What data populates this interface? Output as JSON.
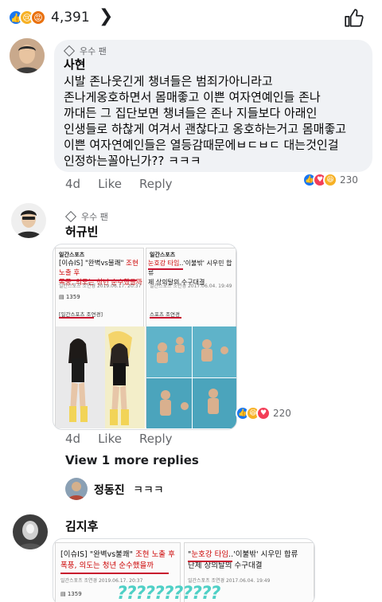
{
  "top": {
    "reaction_count": "4,391",
    "chevron": "❯"
  },
  "comments": [
    {
      "badge": "우수 팬",
      "author": "사현",
      "lines": [
        "시발 존나웃긴게 챙녀들은 범죄가아니라고",
        "존나게옹호하면서 몸매좋고 이쁜 여자연예인들 존나",
        "까대든 그 집단보면 챙녀들은 존나 지들보다 아래인",
        "인생들로 하찮게 여겨서 괜찮다고 옹호하는거고 몸매좋고",
        "이쁜 여자연예인들은 열등감때문에ㅂㄷㅂㄷ 대는것인걸",
        "인정하는꼴아닌가?? ㅋㅋㅋ"
      ],
      "time": "4d",
      "like": "Like",
      "reply": "Reply",
      "react_count": "230"
    },
    {
      "badge": "우수 팬",
      "author": "허규빈",
      "time": "4d",
      "like": "Like",
      "reply": "Reply",
      "react_count": "220",
      "view_more": "View 1 more replies"
    }
  ],
  "reply": {
    "author": "정동진",
    "text": "ㅋㅋㅋ"
  },
  "third": {
    "author": "김지후"
  },
  "news": {
    "card1": {
      "source": "일간스포츠",
      "tag": "[이슈IS]",
      "title1_pre": "\"완벽vs불쾌\"",
      "title1_red": " 조현 노출 후",
      "title2_red": "폭풍, 의도는 청년 순수했을까",
      "meta": "일간스포츠 조연경 2019.06.17. 20:37",
      "views": "1359",
      "reporter": "[일간스포츠 조연경]"
    },
    "card2": {
      "source": "일간스포츠",
      "title1_red": "눈호강 타임",
      "title1_post": "..'이불밖' 시우민 합류",
      "title2": "제 상의탈의 수구대결",
      "title2_alt": "단체 상의탈의 수구대결",
      "meta": "일간스포츠 조연경 2017.06.04. 19:49",
      "reporter": "스포츠 조연경"
    },
    "question_marks": "???????????"
  },
  "colors": {
    "facebook_blue": "#1877f2",
    "bubble_bg": "#f0f2f5",
    "headline_red": "#c8102e",
    "secondary_text": "#65676b"
  }
}
